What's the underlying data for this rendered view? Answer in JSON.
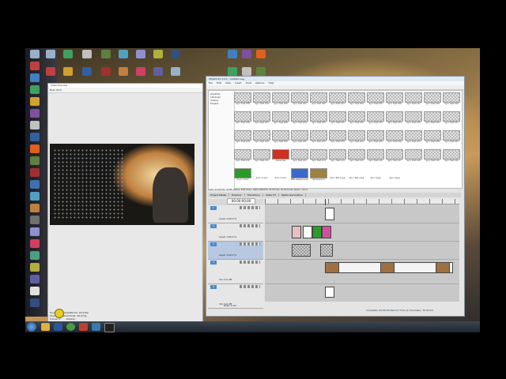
{
  "desktop": {
    "icons": [
      {
        "name": "recycle-bin-icon",
        "color": "#9ab0c8",
        "x": 0
      },
      {
        "name": "desktop-app-icon",
        "color": "#c04040"
      },
      {
        "name": "desktop-app-icon",
        "color": "#4080c0"
      },
      {
        "name": "desktop-app-icon",
        "color": "#40a060"
      }
    ]
  },
  "taskbar": {
    "clock_time": "",
    "clock_date": ""
  },
  "preview_window": {
    "title": "Video Preview",
    "toolbar_text": "Best (Full)",
    "status_line1": "Project: 1920x1080x32, 29.970p",
    "status_line2": "Preview: 480x270x32, 29.970p",
    "frame_label": "Frame:",
    "frame_value": "0",
    "display_label": "Display:"
  },
  "vegas_window": {
    "title": "VEGAS Pro 14.0 - Untitled.veg",
    "menu": [
      "File",
      "Edit",
      "View",
      "Insert",
      "Tools",
      "Options",
      "Help"
    ],
    "tree_items": [
      "Desktop",
      "Libraries",
      "Videos",
      "Project"
    ],
    "media_rows": [
      [
        "Sync Test 238",
        "Sync Test 239",
        "Sync Test 240",
        "Sync Test 241",
        "Sync Test 242",
        "Sync Test 243",
        "Sync Test 244",
        "Sync Test 245",
        "Sync Test 246",
        "Sync Test 247",
        "Sync Test 248",
        "Sync Test 249"
      ],
      [
        "Sync Test 226",
        "Sync Test 227",
        "Sync Test 228",
        "Sync Test 229",
        "Sync Test 230",
        "Sync Test 231",
        "Sync Test 232",
        "Sync Test 233",
        "Sync Test 234",
        "Sync Test 235",
        "Sync Test 236",
        "Sync Test 237"
      ],
      [
        "Sync Test 218",
        "Sync Test 219",
        "Sync Test 220",
        "Sync Test 221",
        "Sync Test 222",
        "Sync Test 223",
        "Sync Test 224",
        "Sync Test 225",
        "Sync Test 226",
        "Sync Test 227",
        "Sync Test 228",
        "Sync Test 229"
      ],
      [
        "Sync Test 210",
        "Sync Test 211",
        "Subscribe",
        "Sync Test 212",
        "Sync Test 213",
        "Sync Test 214",
        "Sync Test 215",
        "Sync Test 216",
        "Sync Test 217",
        "Sync Test 218",
        "Sync Test 219",
        "Sync Test 220"
      ],
      [
        "Sync 1.mov",
        "Sync 2.mov",
        "Sync 3.mov",
        "PNG sequence.png",
        "rainbow.mov",
        "Sync Test 1.jpg",
        "Sync Test 2.jpg",
        "Sync 3.jpg",
        "Sync 4.jpg",
        "",
        "",
        ""
      ]
    ],
    "info_text": "Audio: 44,100 Hz, 16 Bit, Stereo, PCM   Video: 1920x1080x32, 29.970 fps, 00:00:10;00, Alpha = None",
    "tabs": [
      "Project Media",
      "Explorer",
      "Transitions",
      "Video FX",
      "Media Generators"
    ],
    "timecode": "00:00:00;00",
    "tracks": [
      {
        "num": "1",
        "label": "Level: 100.0 %"
      },
      {
        "num": "2",
        "label": "Level: 100.0 %"
      },
      {
        "num": "3",
        "label": "Level: 100.0 %"
      },
      {
        "num": "4",
        "label": "Vol: 0.0 dB"
      },
      {
        "num": "5",
        "label": "Vol: 0.0 dB"
      }
    ],
    "rate_label": "Rate: 0.00",
    "bottom_status": "Complete: 00:00:00   Record Time (2 channels): 10:43:10"
  }
}
